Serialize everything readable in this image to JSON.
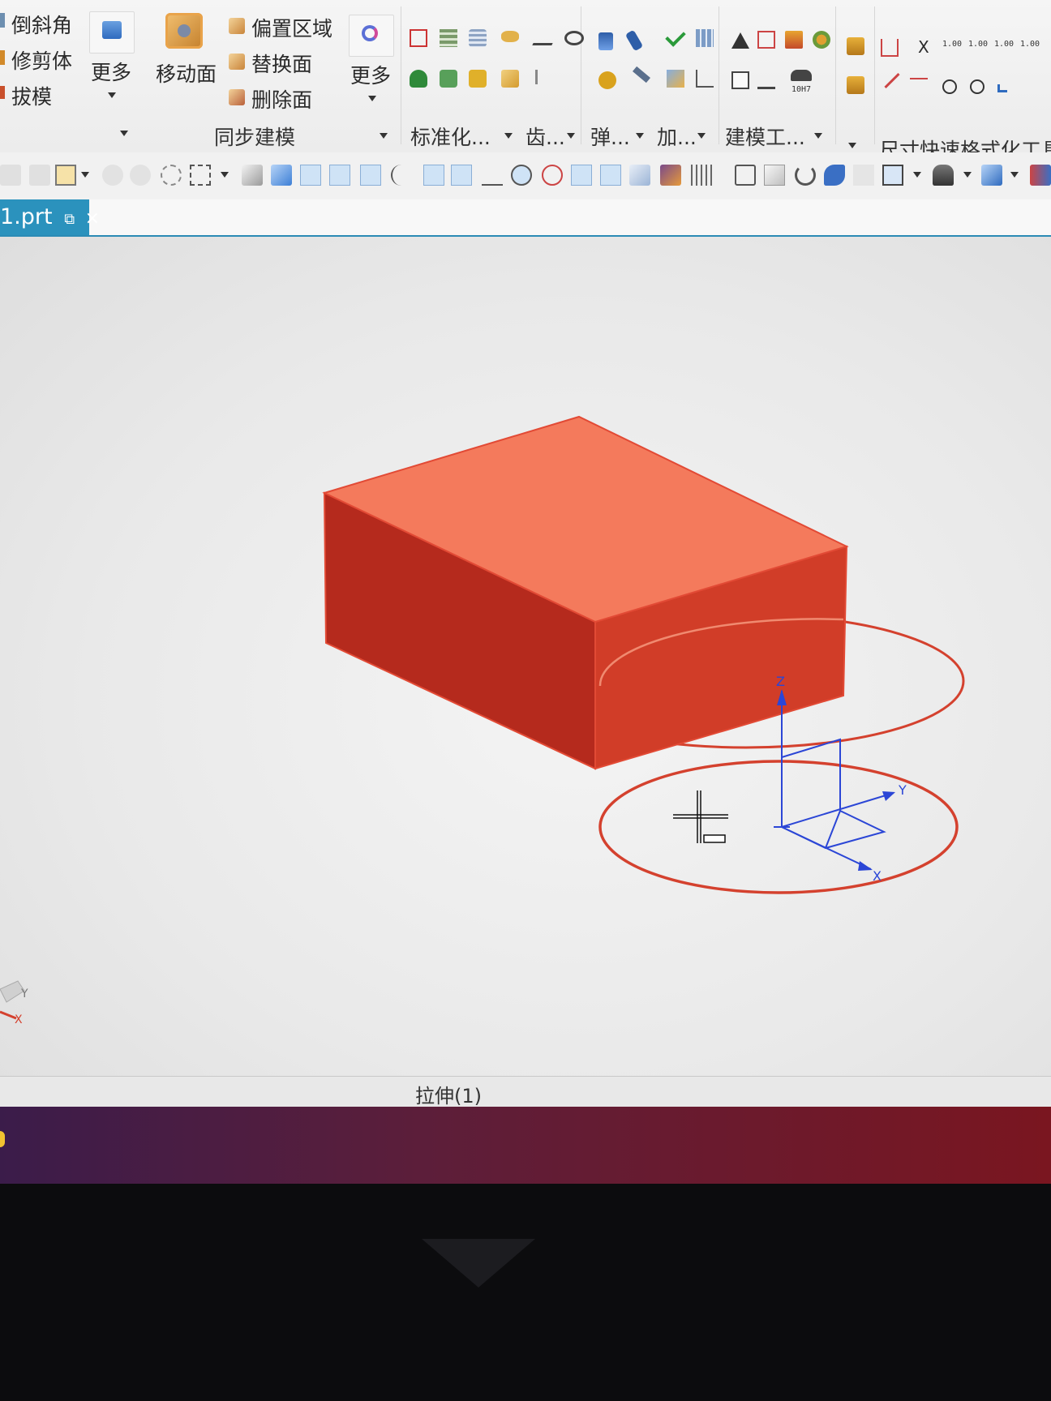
{
  "ribbon": {
    "edit_items": [
      "倒斜角",
      "修剪体",
      "拔模"
    ],
    "more_label": "更多",
    "move_face_label": "移动面",
    "sync_items": [
      "偏置区域",
      "替换面",
      "删除面"
    ],
    "sync_more_label": "更多",
    "groups": [
      "同步建模",
      "标准化...",
      "齿...",
      "弹...",
      "加...",
      "建模工...",
      "尺寸快速格式化工具"
    ],
    "dim_values": [
      "1.00",
      "1.00",
      "1.00",
      "1.00"
    ],
    "tolerance_label": "10H7",
    "close_x": "X"
  },
  "tab": {
    "label": "1.prt",
    "close": "×"
  },
  "viewport": {
    "axis_labels": {
      "z": "Z",
      "y": "Y",
      "x": "X"
    },
    "corner_triad": {
      "y": "Y",
      "x": "X"
    }
  },
  "status": {
    "text": "拉伸(1)"
  },
  "colors": {
    "solid_top": "#f47a5c",
    "solid_front": "#d9402a",
    "solid_side": "#b52a1d",
    "sketch": "#d4412e",
    "csys": "#2b46d6",
    "tab": "#2b92bd"
  }
}
